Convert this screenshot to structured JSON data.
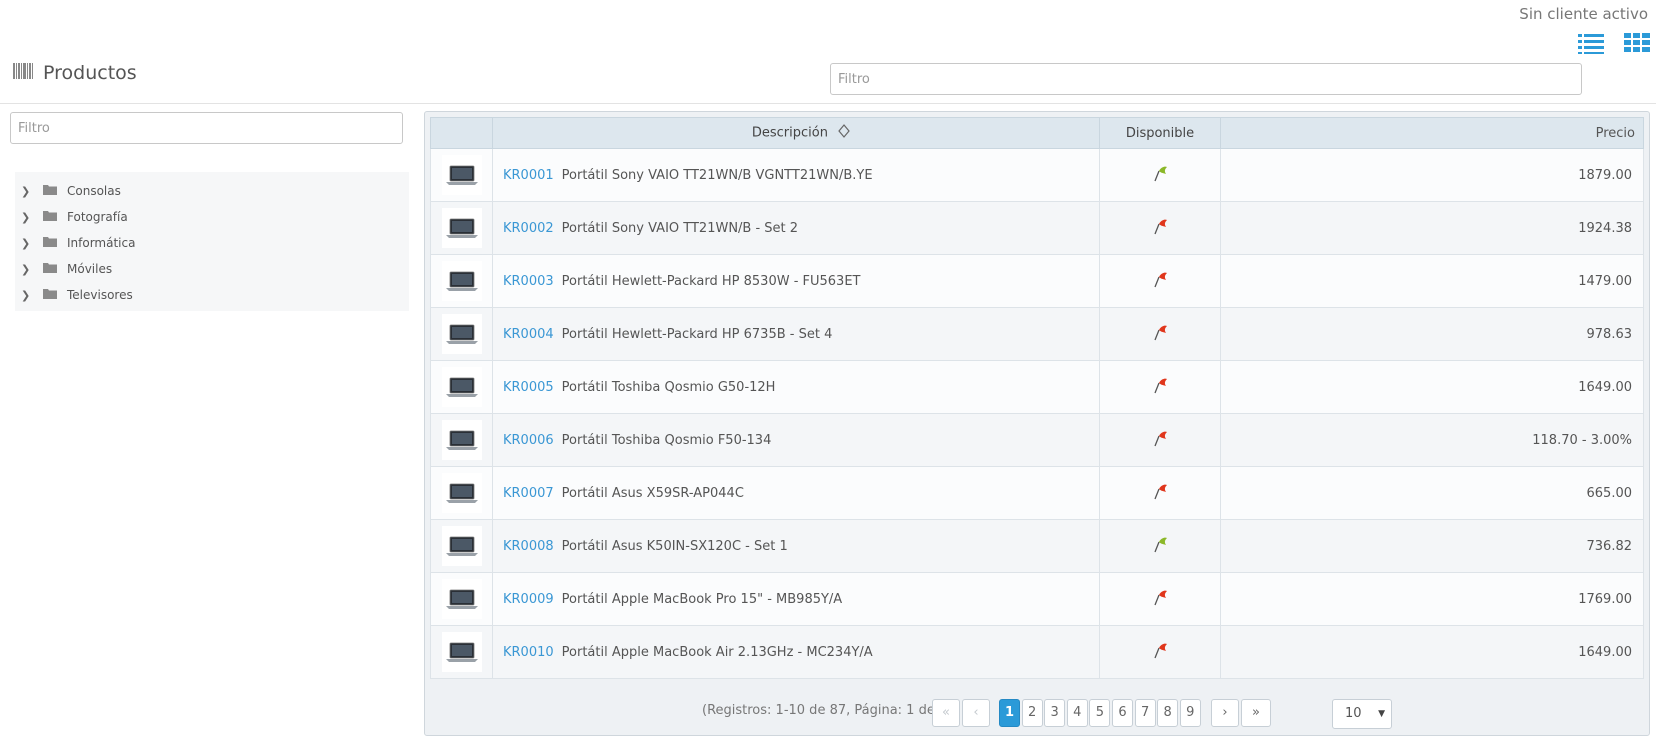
{
  "header": {
    "client_status": "Sin cliente activo",
    "title": "Productos",
    "title_icon": "barcode-icon",
    "filter_placeholder": "Filtro",
    "view_icons": [
      "list-view-icon",
      "grid-view-icon"
    ],
    "accent": "#2b9ad8"
  },
  "sidebar": {
    "filter_placeholder": "Filtro",
    "categories": [
      {
        "label": "Consolas"
      },
      {
        "label": "Fotografía"
      },
      {
        "label": "Informática"
      },
      {
        "label": "Móviles"
      },
      {
        "label": "Televisores"
      }
    ]
  },
  "table": {
    "columns": {
      "description": "Descripción",
      "available": "Disponible",
      "price": "Precio"
    },
    "rows": [
      {
        "code": "KR0001",
        "name": "Portátil Sony VAIO TT21WN/B VGNTT21WN/B.YE",
        "available": "green",
        "price": "1879.00"
      },
      {
        "code": "KR0002",
        "name": "Portátil Sony VAIO TT21WN/B - Set 2",
        "available": "red",
        "price": "1924.38"
      },
      {
        "code": "KR0003",
        "name": "Portátil Hewlett-Packard HP 8530W - FU563ET",
        "available": "red",
        "price": "1479.00"
      },
      {
        "code": "KR0004",
        "name": "Portátil Hewlett-Packard HP 6735B - Set 4",
        "available": "red",
        "price": "978.63"
      },
      {
        "code": "KR0005",
        "name": "Portátil Toshiba Qosmio G50-12H",
        "available": "red",
        "price": "1649.00"
      },
      {
        "code": "KR0006",
        "name": "Portátil Toshiba Qosmio F50-134",
        "available": "red",
        "price": "118.70 - 3.00%"
      },
      {
        "code": "KR0007",
        "name": "Portátil Asus X59SR-AP044C",
        "available": "red",
        "price": "665.00"
      },
      {
        "code": "KR0008",
        "name": "Portátil Asus K50IN-SX120C - Set 1",
        "available": "green",
        "price": "736.82"
      },
      {
        "code": "KR0009",
        "name": "Portátil Apple MacBook Pro 15\" - MB985Y/A",
        "available": "red",
        "price": "1769.00"
      },
      {
        "code": "KR0010",
        "name": "Portátil Apple MacBook Air 2.13GHz - MC234Y/A",
        "available": "red",
        "price": "1649.00"
      }
    ]
  },
  "pager": {
    "info": "(Registros: 1-10 de 87, Página: 1 de 9)",
    "pages": [
      "1",
      "2",
      "3",
      "4",
      "5",
      "6",
      "7",
      "8",
      "9"
    ],
    "current_page": "1",
    "first": "«",
    "prev": "‹",
    "next": "›",
    "last": "»",
    "rows_per_page": "10"
  }
}
